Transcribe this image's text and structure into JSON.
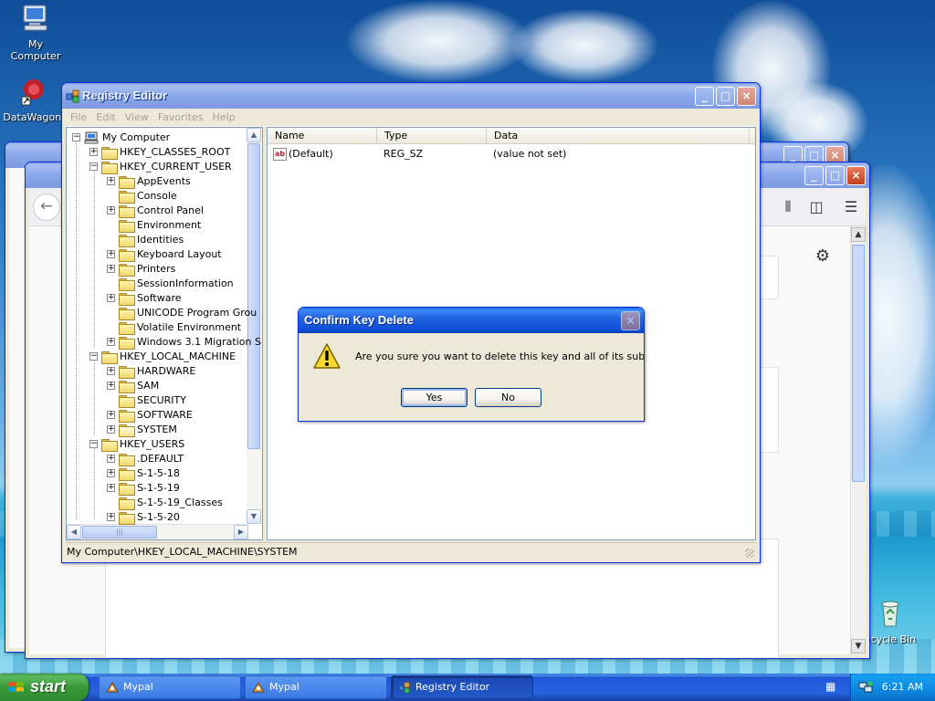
{
  "desktop": {
    "icons": [
      {
        "label": "My Computer"
      },
      {
        "label": "DataWagon."
      },
      {
        "label": "ecycle Bin"
      }
    ]
  },
  "background_windows": {
    "browser_nav_icons": [
      "library-icon",
      "sidebar-icon",
      "menu-icon",
      "gear-icon"
    ]
  },
  "registry_editor": {
    "title": "Registry Editor",
    "menu": [
      "File",
      "Edit",
      "View",
      "Favorites",
      "Help"
    ],
    "columns": [
      "Name",
      "Type",
      "Data"
    ],
    "values": [
      {
        "name": "(Default)",
        "type": "REG_SZ",
        "data": "(value not set)"
      }
    ],
    "tree": [
      {
        "label": "My Computer",
        "level": 0,
        "expander": "−",
        "icon": "computer"
      },
      {
        "label": "HKEY_CLASSES_ROOT",
        "level": 1,
        "expander": "+"
      },
      {
        "label": "HKEY_CURRENT_USER",
        "level": 1,
        "expander": "−"
      },
      {
        "label": "AppEvents",
        "level": 2,
        "expander": "+"
      },
      {
        "label": "Console",
        "level": 2,
        "expander": ""
      },
      {
        "label": "Control Panel",
        "level": 2,
        "expander": "+"
      },
      {
        "label": "Environment",
        "level": 2,
        "expander": ""
      },
      {
        "label": "Identities",
        "level": 2,
        "expander": ""
      },
      {
        "label": "Keyboard Layout",
        "level": 2,
        "expander": "+"
      },
      {
        "label": "Printers",
        "level": 2,
        "expander": "+"
      },
      {
        "label": "SessionInformation",
        "level": 2,
        "expander": ""
      },
      {
        "label": "Software",
        "level": 2,
        "expander": "+"
      },
      {
        "label": "UNICODE Program Grou",
        "level": 2,
        "expander": ""
      },
      {
        "label": "Volatile Environment",
        "level": 2,
        "expander": ""
      },
      {
        "label": "Windows 3.1 Migration S",
        "level": 2,
        "expander": "+"
      },
      {
        "label": "HKEY_LOCAL_MACHINE",
        "level": 1,
        "expander": "−"
      },
      {
        "label": "HARDWARE",
        "level": 2,
        "expander": "+"
      },
      {
        "label": "SAM",
        "level": 2,
        "expander": "+"
      },
      {
        "label": "SECURITY",
        "level": 2,
        "expander": ""
      },
      {
        "label": "SOFTWARE",
        "level": 2,
        "expander": "+"
      },
      {
        "label": "SYSTEM",
        "level": 2,
        "expander": "+",
        "icon": "open"
      },
      {
        "label": "HKEY_USERS",
        "level": 1,
        "expander": "−"
      },
      {
        "label": ".DEFAULT",
        "level": 2,
        "expander": "+"
      },
      {
        "label": "S-1-5-18",
        "level": 2,
        "expander": "+"
      },
      {
        "label": "S-1-5-19",
        "level": 2,
        "expander": "+"
      },
      {
        "label": "S-1-5-19_Classes",
        "level": 2,
        "expander": ""
      },
      {
        "label": "S-1-5-20",
        "level": 2,
        "expander": "+"
      }
    ],
    "status": "My Computer\\HKEY_LOCAL_MACHINE\\SYSTEM"
  },
  "dialog": {
    "title": "Confirm Key Delete",
    "message": "Are you sure you want to delete this key and all of its subkeys?",
    "yes": "Yes",
    "no": "No"
  },
  "taskbar": {
    "start": "start",
    "tasks": [
      {
        "label": "Mypal",
        "active": false
      },
      {
        "label": "Mypal",
        "active": false
      },
      {
        "label": "Registry Editor",
        "active": true
      }
    ],
    "clock": "6:21 AM"
  },
  "colors": {
    "xp_blue": "#0a4ed8",
    "start_green": "#399a39",
    "dialog_face": "#ece9d8"
  }
}
